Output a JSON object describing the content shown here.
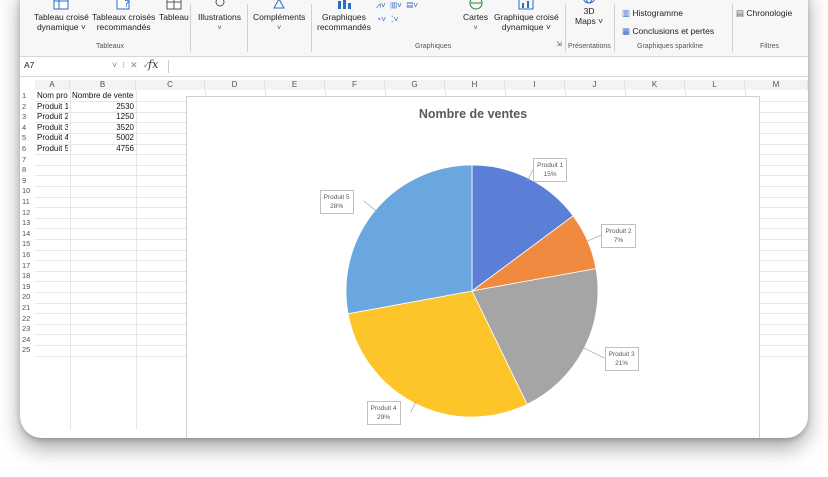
{
  "ribbon": {
    "buttons": [
      {
        "id": "pivot",
        "label1": "Tableau croisé",
        "label2": "dynamique ˅"
      },
      {
        "id": "rec_pivot",
        "label1": "Tableaux croisés",
        "label2": "recommandés"
      },
      {
        "id": "table",
        "label1": "Tableau",
        "label2": ""
      },
      {
        "id": "illus",
        "label1": "Illustrations",
        "label2": "˅"
      },
      {
        "id": "addins",
        "label1": "Compléments",
        "label2": "˅"
      },
      {
        "id": "rec_charts",
        "label1": "Graphiques",
        "label2": "recommandés"
      },
      {
        "id": "maps",
        "label1": "Cartes",
        "label2": "˅"
      },
      {
        "id": "pivot_chart",
        "label1": "Graphique croisé",
        "label2": "dynamique ˅"
      },
      {
        "id": "maps3d",
        "label1": "3D",
        "label2": "Maps ˅"
      },
      {
        "id": "hist",
        "label1": "Histogramme",
        "label2": ""
      },
      {
        "id": "winloss",
        "label1": "Conclusions et pertes",
        "label2": ""
      },
      {
        "id": "timeline",
        "label1": "Chronologie",
        "label2": ""
      }
    ],
    "groups": {
      "tableaux": "Tableaux",
      "graphiques": "Graphiques",
      "presentations": "Présentations",
      "sparkline": "Graphiques sparkline",
      "filtres": "Filtres"
    }
  },
  "formula_bar": {
    "name_box": "A7",
    "fx": "fx",
    "content": ""
  },
  "columns": [
    "A",
    "B",
    "C",
    "D",
    "E",
    "F",
    "G",
    "H",
    "I",
    "J",
    "K",
    "L",
    "M"
  ],
  "rows": [
    "1",
    "2",
    "3",
    "4",
    "5",
    "6",
    "7",
    "8",
    "9",
    "10",
    "11",
    "12",
    "13",
    "14",
    "15",
    "16",
    "17",
    "18",
    "19",
    "20",
    "21",
    "22",
    "23",
    "24",
    "25"
  ],
  "table": {
    "headers": [
      "Nom produit",
      "Nombre de ventes"
    ],
    "data": [
      [
        "Produit 1",
        "2530"
      ],
      [
        "Produit 2",
        "1250"
      ],
      [
        "Produit 3",
        "3520"
      ],
      [
        "Produit 4",
        "5002"
      ],
      [
        "Produit 5",
        "4756"
      ]
    ]
  },
  "chart_data": {
    "type": "pie",
    "title": "Nombre de ventes",
    "categories": [
      "Produit 1",
      "Produit 2",
      "Produit 3",
      "Produit 4",
      "Produit 5"
    ],
    "values": [
      2530,
      1250,
      3520,
      5002,
      4756
    ],
    "data_labels": [
      "15%",
      "7%",
      "21%",
      "29%",
      "28%"
    ],
    "colors": [
      "#5b7fd6",
      "#f08a40",
      "#a5a5a5",
      "#fdc52a",
      "#6aa7df"
    ]
  }
}
